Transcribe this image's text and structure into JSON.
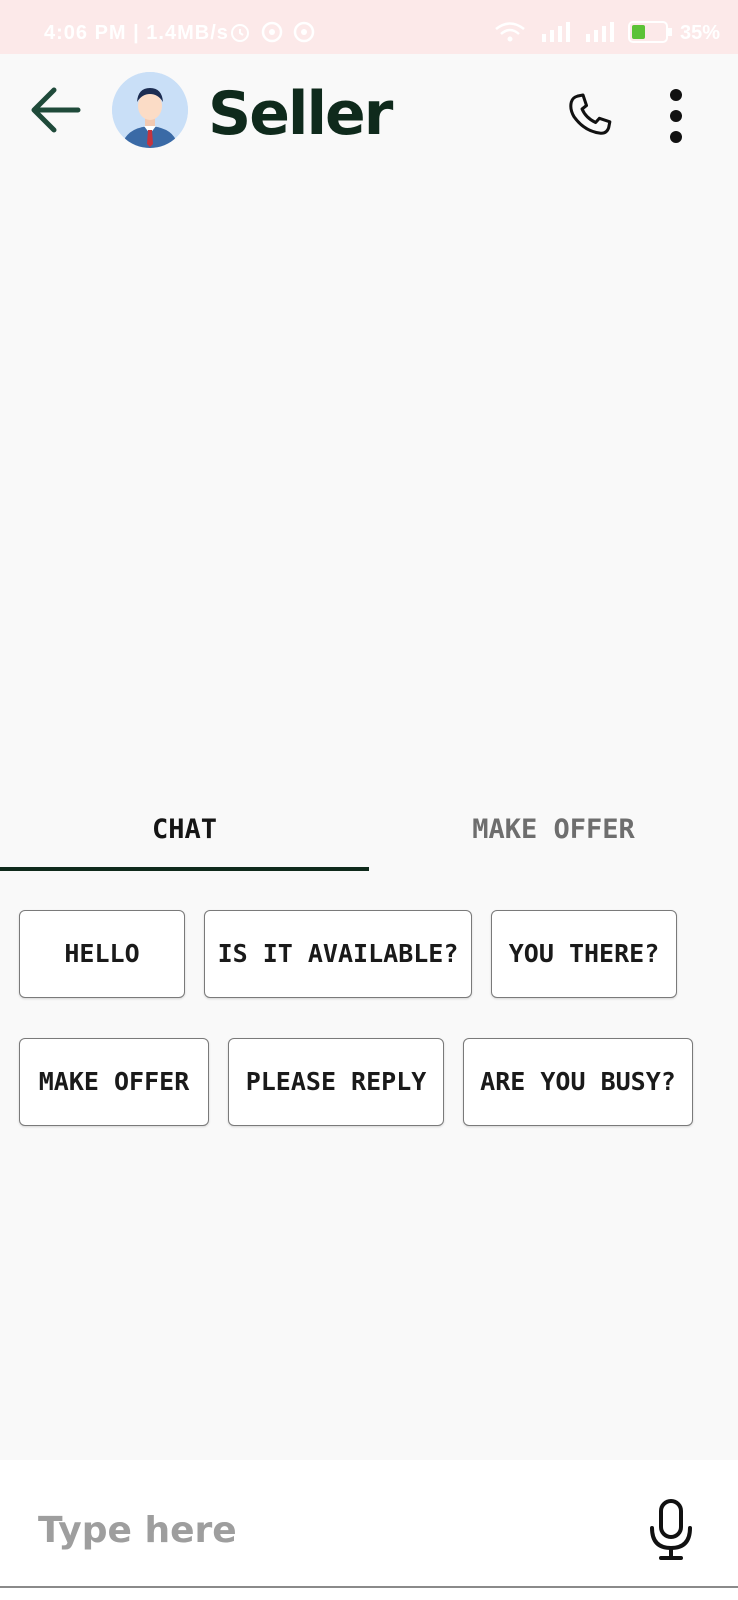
{
  "status_bar": {
    "time": "4:06 PM | 1.4MB/s",
    "battery": "35%"
  },
  "header": {
    "title": "Seller"
  },
  "tabs": [
    {
      "label": "CHAT",
      "selected": true
    },
    {
      "label": "MAKE OFFER",
      "selected": false
    }
  ],
  "quick_replies": [
    "HELLO",
    "IS IT AVAILABLE?",
    "YOU THERE?",
    "MAKE OFFER",
    "PLEASE REPLY",
    "ARE YOU BUSY?"
  ],
  "input": {
    "placeholder": "Type here",
    "value": ""
  },
  "colors": {
    "status_bar_bg": "#fce9e9",
    "brand_dark_green": "#0f2a1c",
    "background": "#f9f9f9"
  },
  "icons": {
    "back": "arrow-left-icon",
    "call": "phone-icon",
    "more": "more-vertical-icon",
    "mic": "microphone-icon"
  }
}
